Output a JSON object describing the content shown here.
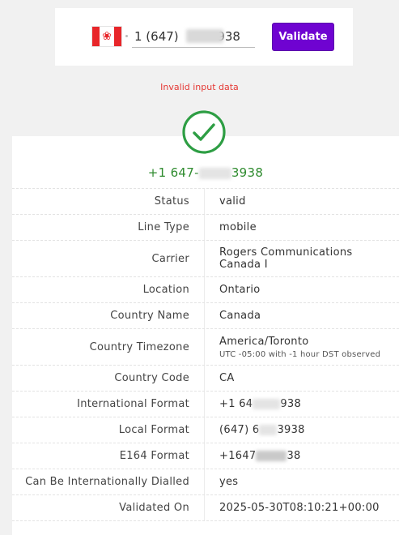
{
  "form": {
    "country_flag_icon": "canada-flag-icon",
    "phone_value": "1 (647)          938",
    "validate_label": "Validate",
    "button_color": "#6f03d1"
  },
  "error_message": "Invalid input data",
  "result": {
    "status_icon": "check-circle-icon",
    "status_color": "#2e8b2e",
    "number_prefix": "+1 647-",
    "number_suffix": "3938",
    "rows": [
      {
        "label": "Status",
        "value": "valid"
      },
      {
        "label": "Line Type",
        "value": "mobile"
      },
      {
        "label": "Carrier",
        "value": "Rogers Communications",
        "value2": "Canada I"
      },
      {
        "label": "Location",
        "value": "Ontario"
      },
      {
        "label": "Country Name",
        "value": "Canada"
      },
      {
        "label": "Country Timezone",
        "value": "America/Toronto",
        "sub": "UTC -05:00 with -1 hour DST observed"
      },
      {
        "label": "Country Code",
        "value": "CA"
      },
      {
        "label": "International Format",
        "value_a": "+1 64",
        "value_b": "938"
      },
      {
        "label": "Local Format",
        "value_a": "(647) 6",
        "value_b": "3938"
      },
      {
        "label": "E164 Format",
        "value_a": "+1647",
        "value_b": "38"
      },
      {
        "label": "Can Be Internationally Dialled",
        "value": "yes"
      },
      {
        "label": "Validated On",
        "value": "2025-05-30T08:10:21+00:00"
      }
    ]
  }
}
